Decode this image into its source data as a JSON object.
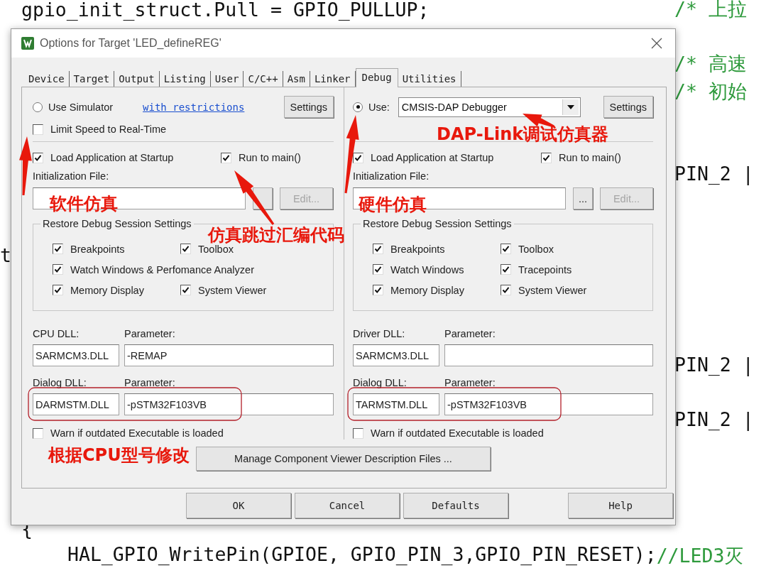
{
  "editor": {
    "lines": [
      {
        "code": "gpio_init_struct.Pull = GPIO_PULLUP;",
        "comment": "/* 上拉"
      },
      {
        "comment": "/* 高速"
      },
      {
        "comment": "/* 初始"
      },
      {
        "code": "PIN_2 |"
      },
      {
        "code": "t"
      },
      {
        "code": "PIN_2 |"
      },
      {
        "code": "PIN_2 |"
      },
      {
        "code": "{"
      },
      {
        "code": "HAL_GPIO_WritePin(GPIOE, GPIO_PIN_3,GPIO_PIN_RESET);",
        "comment": "//LED3灭"
      }
    ]
  },
  "dialog": {
    "title": "Options for Target 'LED_defineREG'",
    "tabs": [
      {
        "label": "Device",
        "selected": false
      },
      {
        "label": "Target",
        "selected": false
      },
      {
        "label": "Output",
        "selected": false
      },
      {
        "label": "Listing",
        "selected": false
      },
      {
        "label": "User",
        "selected": false
      },
      {
        "label": "C/C++",
        "selected": false
      },
      {
        "label": "Asm",
        "selected": false
      },
      {
        "label": "Linker",
        "selected": false
      },
      {
        "label": "Debug",
        "selected": true
      },
      {
        "label": "Utilities",
        "selected": false
      }
    ],
    "columns": [
      {
        "target": {
          "kind": "simulator",
          "label": "Use Simulator",
          "selected": false,
          "link": "with restrictions",
          "settings": "Settings"
        },
        "limit_speed": {
          "label": "Limit Speed to Real-Time",
          "checked": false
        },
        "load_app": {
          "label": "Load Application at Startup",
          "checked": true
        },
        "run_to_main": {
          "label": "Run to main()",
          "checked": true
        },
        "init_file": {
          "label": "Initialization File:",
          "edit": "Edit...",
          "edit_disabled": true
        },
        "restore": {
          "legend": "Restore Debug Session Settings",
          "rows": [
            [
              {
                "label": "Breakpoints",
                "checked": true
              },
              {
                "label": "Toolbox",
                "checked": true
              }
            ],
            [
              {
                "label": "Watch Windows & Perfomance Analyzer",
                "checked": true
              }
            ],
            [
              {
                "label": "Memory Display",
                "checked": true
              },
              {
                "label": "System Viewer",
                "checked": true
              }
            ]
          ]
        },
        "dll": [
          {
            "label": "CPU DLL:",
            "param_label": "Parameter:",
            "value": "SARMCM3.DLL",
            "param": "-REMAP"
          },
          {
            "label": "Dialog DLL:",
            "param_label": "Parameter:",
            "value": "DARMSTM.DLL",
            "param": "-pSTM32F103VB"
          }
        ],
        "warn": {
          "label": "Warn if outdated Executable is loaded",
          "checked": false
        }
      },
      {
        "target": {
          "kind": "debugger",
          "label": "Use:",
          "selected": true,
          "driver": "CMSIS-DAP Debugger",
          "settings": "Settings"
        },
        "load_app": {
          "label": "Load Application at Startup",
          "checked": true
        },
        "run_to_main": {
          "label": "Run to main()",
          "checked": true
        },
        "init_file": {
          "label": "Initialization File:",
          "browse": "...",
          "edit": "Edit...",
          "edit_disabled": true
        },
        "restore": {
          "legend": "Restore Debug Session Settings",
          "rows": [
            [
              {
                "label": "Breakpoints",
                "checked": true
              },
              {
                "label": "Toolbox",
                "checked": true
              }
            ],
            [
              {
                "label": "Watch Windows",
                "checked": true
              },
              {
                "label": "Tracepoints",
                "checked": true
              }
            ],
            [
              {
                "label": "Memory Display",
                "checked": true
              },
              {
                "label": "System Viewer",
                "checked": true
              }
            ]
          ]
        },
        "dll": [
          {
            "label": "Driver DLL:",
            "param_label": "Parameter:",
            "value": "SARMCM3.DLL"
          },
          {
            "label": "Dialog DLL:",
            "param_label": "Parameter:",
            "value": "TARMSTM.DLL",
            "param": "-pSTM32F103VB"
          }
        ],
        "warn": {
          "label": "Warn if outdated Executable is loaded",
          "checked": false
        }
      }
    ],
    "manage_button": "Manage Component Viewer Description Files ...",
    "buttons": [
      "OK",
      "Cancel",
      "Defaults",
      "Help"
    ]
  },
  "annotations": [
    {
      "kind": "label",
      "text": "软件仿真"
    },
    {
      "kind": "label",
      "text": "仿真跳过汇编代码"
    },
    {
      "kind": "label",
      "text": "硬件仿真"
    },
    {
      "kind": "label",
      "text": "DAP-Link调试仿真器"
    },
    {
      "kind": "label",
      "text": "根据CPU型号修改"
    },
    {
      "kind": "arrow"
    },
    {
      "kind": "arrow"
    },
    {
      "kind": "arrow"
    },
    {
      "kind": "arrow"
    },
    {
      "kind": "frame"
    },
    {
      "kind": "frame"
    }
  ]
}
